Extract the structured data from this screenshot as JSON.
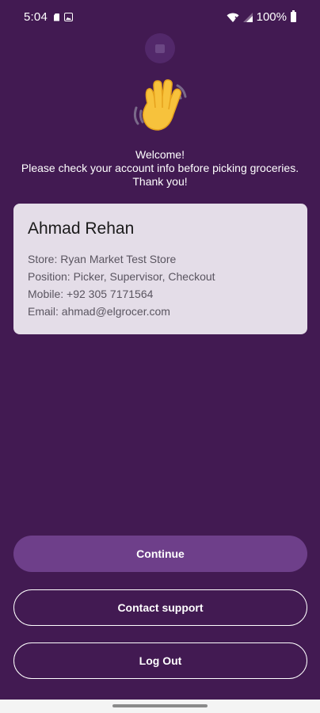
{
  "status_bar": {
    "time": "5:04",
    "battery": "100%"
  },
  "welcome": {
    "line1": "Welcome!",
    "line2": "Please check your account info before picking groceries. Thank you!"
  },
  "account": {
    "name": "Ahmad Rehan",
    "store": "Store: Ryan Market Test Store",
    "position": "Position: Picker, Supervisor, Checkout",
    "mobile": "Mobile: +92 305 7171564",
    "email": "Email: ahmad@elgrocer.com"
  },
  "buttons": {
    "continue": "Continue",
    "contact_support": "Contact support",
    "log_out": "Log Out"
  },
  "icons": {
    "wave": "waving-hand-icon",
    "wifi": "wifi-icon",
    "signal": "signal-icon",
    "battery": "battery-icon"
  },
  "colors": {
    "background": "#421a52",
    "card": "#e4dde8",
    "primary_button": "#6e3f8a",
    "text_on_dark": "#ffffff"
  }
}
